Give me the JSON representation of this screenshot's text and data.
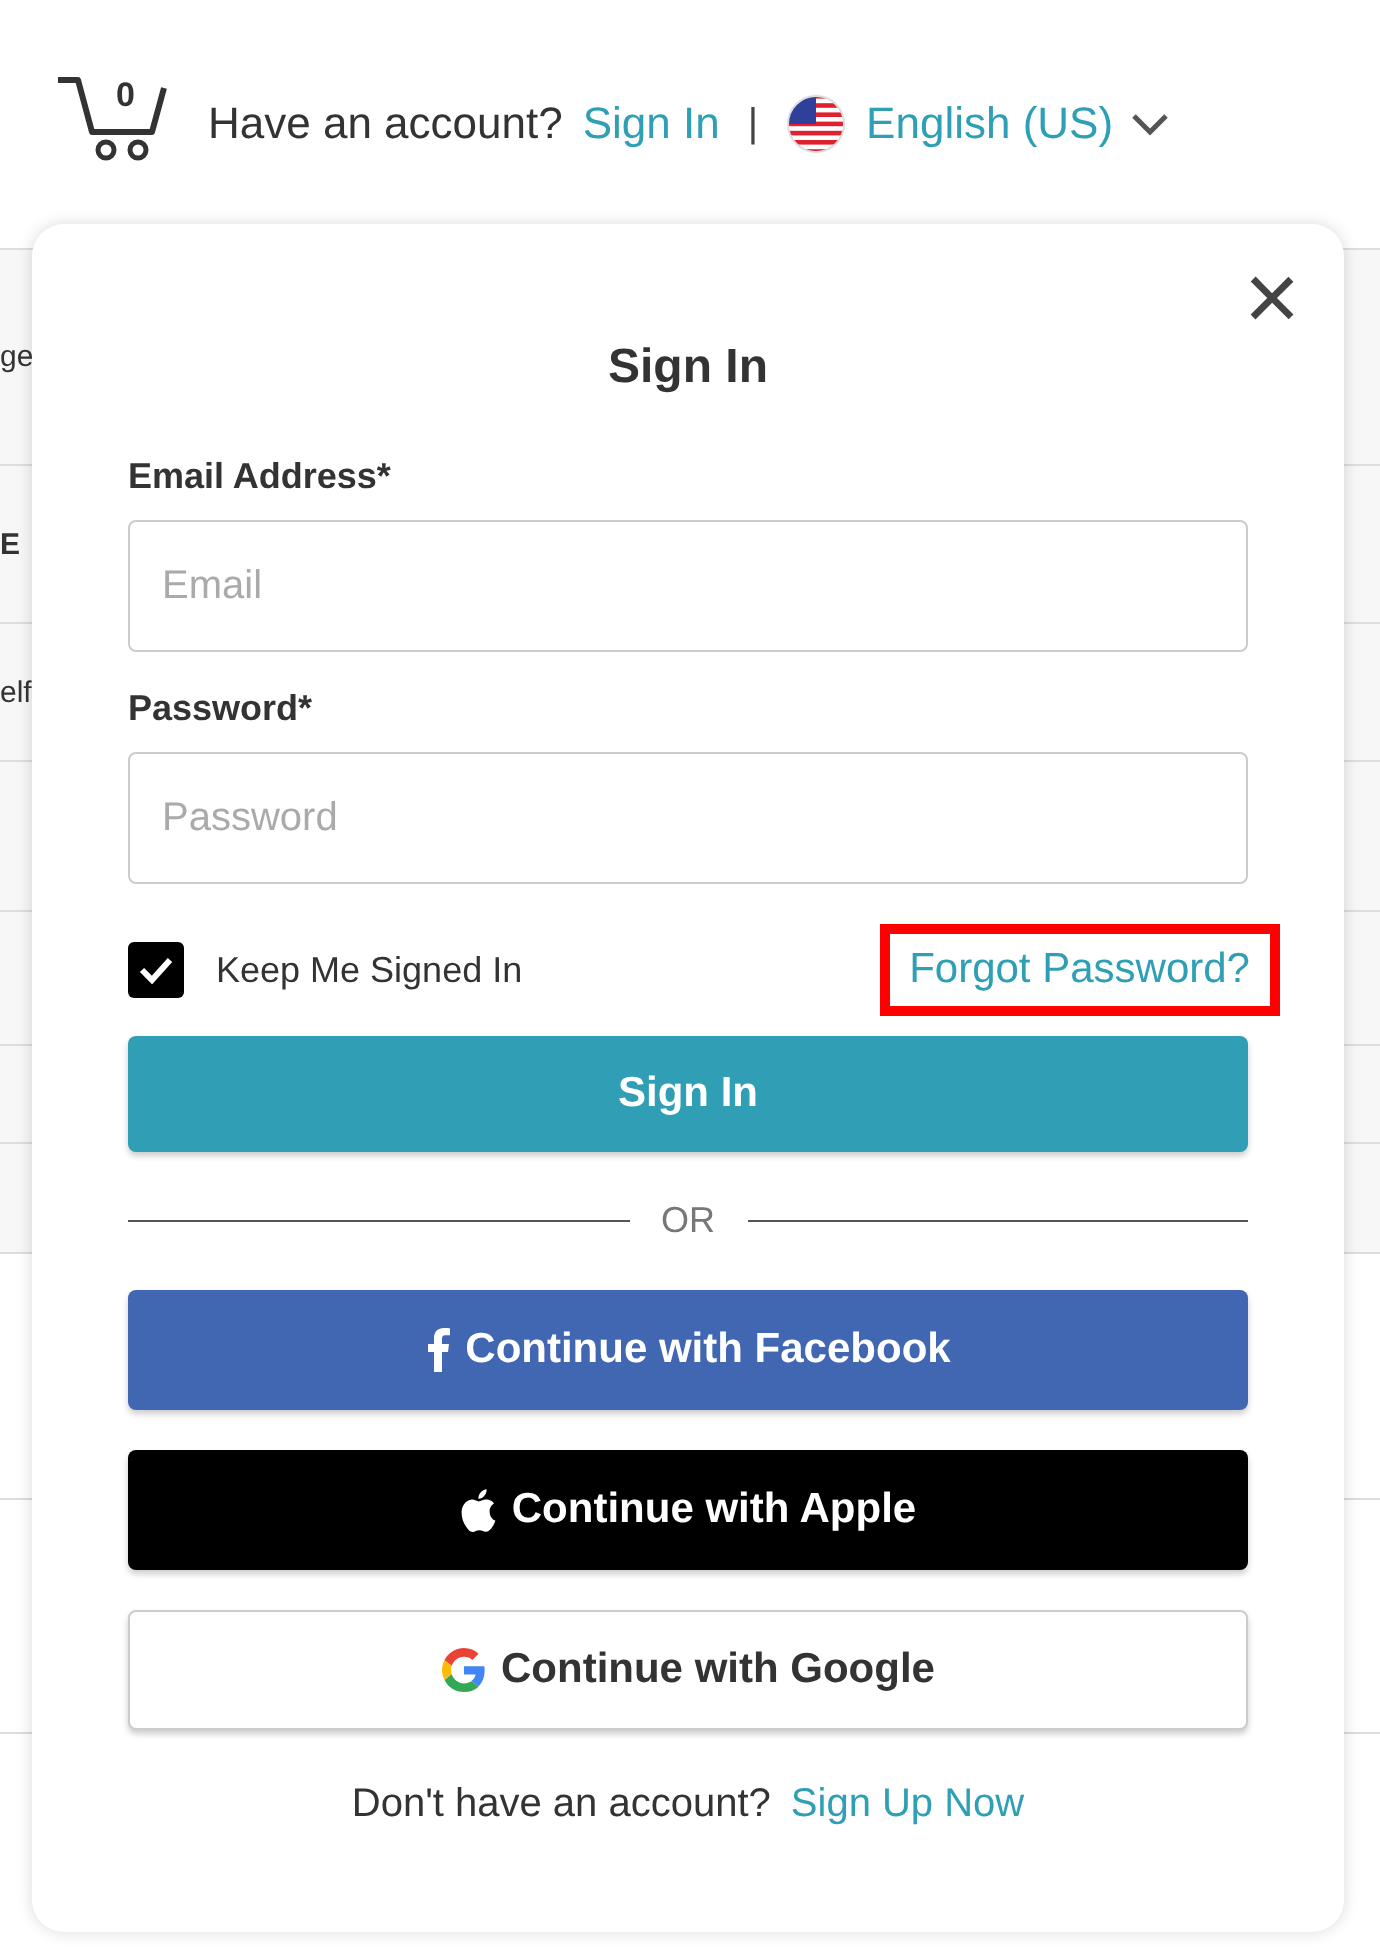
{
  "header": {
    "cart_count": "0",
    "account_prompt": "Have an account?",
    "sign_in_link": "Sign In",
    "separator": "|",
    "language": "English (US)"
  },
  "background_rows": [
    {
      "text": "ge",
      "bold": false
    },
    {
      "text": "E",
      "bold": true
    },
    {
      "text": "elf",
      "bold": false
    }
  ],
  "modal": {
    "close": "×",
    "title": "Sign In",
    "fields": [
      {
        "label": "Email Address*",
        "placeholder": "Email"
      },
      {
        "label": "Password*",
        "placeholder": "Password"
      }
    ],
    "keep_signed_in": {
      "label": "Keep Me Signed In",
      "checked": true
    },
    "forgot_link": {
      "text": "Forgot Password?",
      "highlighted": true
    },
    "submit": "Sign In",
    "divider": "OR",
    "social_buttons": [
      {
        "kind": "facebook",
        "label": "Continue with Facebook"
      },
      {
        "kind": "apple",
        "label": "Continue with Apple"
      },
      {
        "kind": "google",
        "label": "Continue with Google"
      }
    ],
    "footer_prompt": "Don't have an account?",
    "signup_link": "Sign Up Now"
  }
}
